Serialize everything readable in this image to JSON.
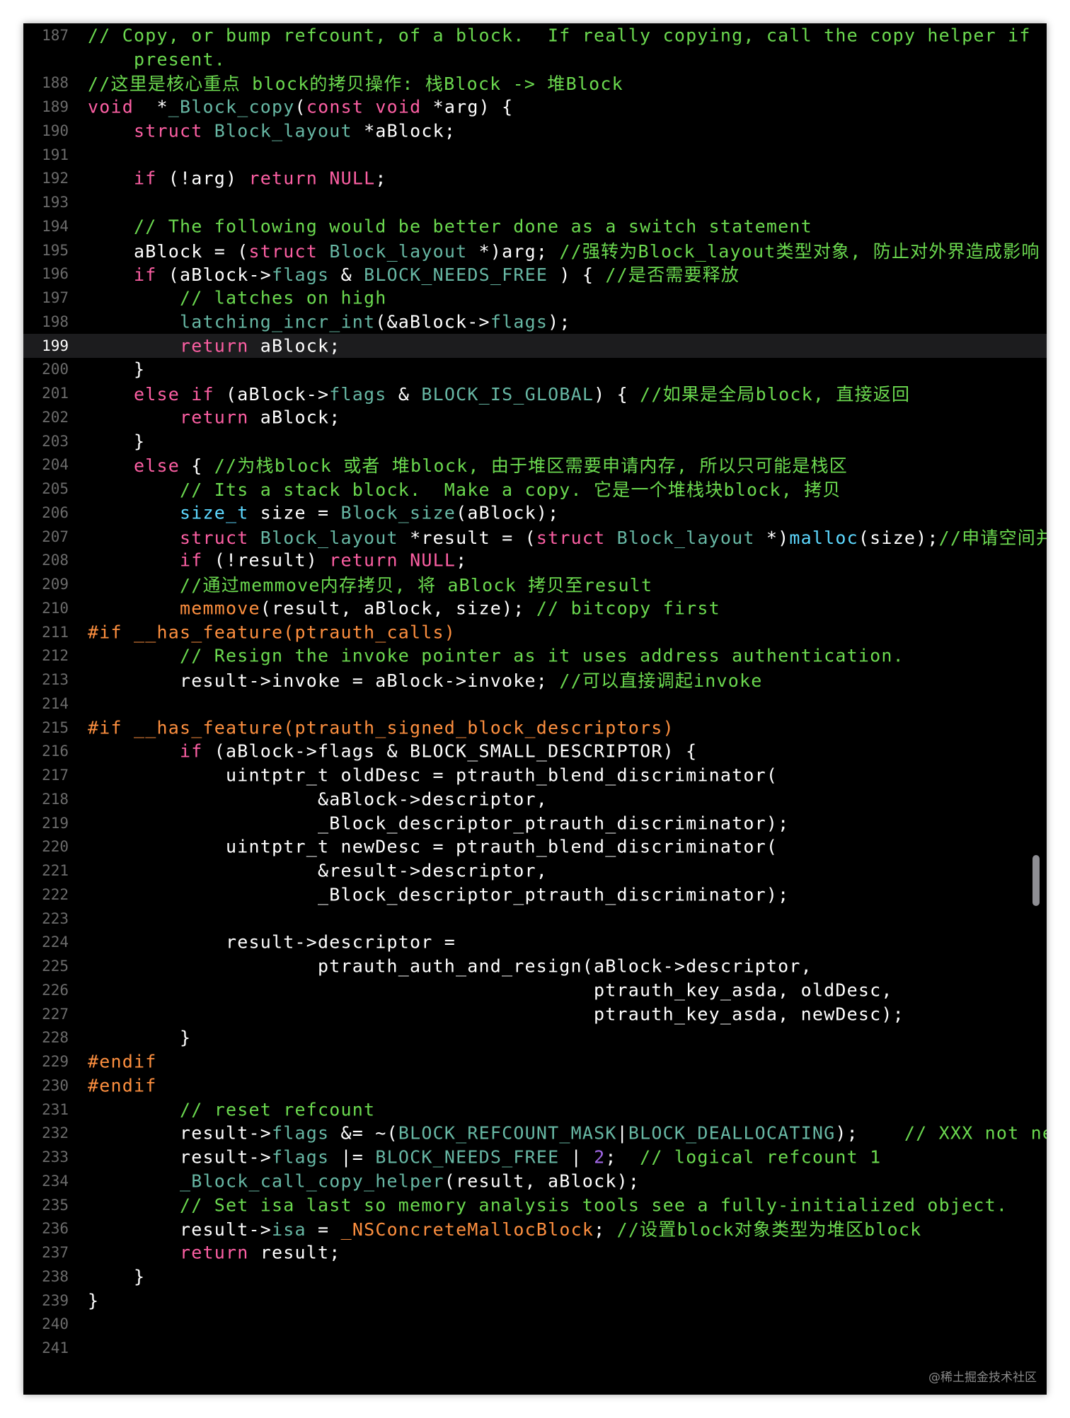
{
  "editor": {
    "colors": {
      "background": "#000000",
      "keyword": "#fc5fa3",
      "type": "#5dd8ff",
      "project_symbol": "#67b7a4",
      "number": "#a167e6",
      "comment": "#6bd94f",
      "preprocessor": "#fd8f3f",
      "function": "#41a1c0",
      "plain": "#ffffff",
      "line_number": "#6b6b6b"
    },
    "current_line": 199,
    "lines": [
      {
        "n": "187",
        "tokens": [
          [
            "c",
            "// Copy, or bump refcount, of a block.  If really copying, call the copy helper if"
          ]
        ]
      },
      {
        "n": "",
        "tokens": [
          [
            "c",
            "    present."
          ]
        ]
      },
      {
        "n": "188",
        "tokens": [
          [
            "c",
            "//这里是核心重点 block的拷贝操作: 栈Block -> 堆Block"
          ]
        ]
      },
      {
        "n": "189",
        "tokens": [
          [
            "k",
            "void"
          ],
          [
            "",
            "  *"
          ],
          [
            "p",
            "_Block_copy"
          ],
          [
            "",
            "("
          ],
          [
            "k",
            "const void"
          ],
          [
            "",
            " *arg) {"
          ]
        ]
      },
      {
        "n": "190",
        "tokens": [
          [
            "",
            "    "
          ],
          [
            "k",
            "struct"
          ],
          [
            "",
            " "
          ],
          [
            "p",
            "Block_layout"
          ],
          [
            "",
            " *aBlock;"
          ]
        ]
      },
      {
        "n": "191",
        "tokens": []
      },
      {
        "n": "192",
        "tokens": [
          [
            "",
            "    "
          ],
          [
            "k",
            "if"
          ],
          [
            "",
            " (!arg) "
          ],
          [
            "k",
            "return"
          ],
          [
            "",
            " "
          ],
          [
            "k",
            "NULL"
          ],
          [
            "",
            ";"
          ]
        ]
      },
      {
        "n": "193",
        "tokens": []
      },
      {
        "n": "194",
        "tokens": [
          [
            "",
            "    "
          ],
          [
            "c",
            "// The following would be better done as a switch statement"
          ]
        ]
      },
      {
        "n": "195",
        "tokens": [
          [
            "",
            "    aBlock = ("
          ],
          [
            "k",
            "struct"
          ],
          [
            "",
            " "
          ],
          [
            "p",
            "Block_layout"
          ],
          [
            "",
            " *)arg; "
          ],
          [
            "c",
            "//强转为Block_layout类型对象, 防止对外界造成影响"
          ]
        ]
      },
      {
        "n": "196",
        "tokens": [
          [
            "",
            "    "
          ],
          [
            "k",
            "if"
          ],
          [
            "",
            " (aBlock->"
          ],
          [
            "p",
            "flags"
          ],
          [
            "",
            " & "
          ],
          [
            "p",
            "BLOCK_NEEDS_FREE"
          ],
          [
            "",
            " ) { "
          ],
          [
            "c",
            "//是否需要释放"
          ]
        ]
      },
      {
        "n": "197",
        "tokens": [
          [
            "",
            "        "
          ],
          [
            "c",
            "// latches on high"
          ]
        ]
      },
      {
        "n": "198",
        "tokens": [
          [
            "",
            "        "
          ],
          [
            "p",
            "latching_incr_int"
          ],
          [
            "",
            "(&aBlock->"
          ],
          [
            "p",
            "flags"
          ],
          [
            "",
            ");"
          ]
        ]
      },
      {
        "n": "199",
        "tokens": [
          [
            "",
            "        "
          ],
          [
            "k",
            "return"
          ],
          [
            "",
            " aBlock;"
          ]
        ]
      },
      {
        "n": "200",
        "tokens": [
          [
            "",
            "    }"
          ]
        ]
      },
      {
        "n": "201",
        "tokens": [
          [
            "",
            "    "
          ],
          [
            "k",
            "else if"
          ],
          [
            "",
            " (aBlock->"
          ],
          [
            "p",
            "flags"
          ],
          [
            "",
            " & "
          ],
          [
            "p",
            "BLOCK_IS_GLOBAL"
          ],
          [
            "",
            ") { "
          ],
          [
            "c",
            "//如果是全局block, 直接返回"
          ]
        ]
      },
      {
        "n": "202",
        "tokens": [
          [
            "",
            "        "
          ],
          [
            "k",
            "return"
          ],
          [
            "",
            " aBlock;"
          ]
        ]
      },
      {
        "n": "203",
        "tokens": [
          [
            "",
            "    }"
          ]
        ]
      },
      {
        "n": "204",
        "tokens": [
          [
            "",
            "    "
          ],
          [
            "k",
            "else"
          ],
          [
            "",
            " { "
          ],
          [
            "c",
            "//为栈block 或者 堆block, 由于堆区需要申请内存, 所以只可能是栈区"
          ]
        ]
      },
      {
        "n": "205",
        "tokens": [
          [
            "",
            "        "
          ],
          [
            "c",
            "// Its a stack block.  Make a copy. 它是一个堆栈块block, 拷贝"
          ]
        ]
      },
      {
        "n": "206",
        "tokens": [
          [
            "",
            "        "
          ],
          [
            "t",
            "size_t"
          ],
          [
            "",
            " size = "
          ],
          [
            "p",
            "Block_size"
          ],
          [
            "",
            "(aBlock);"
          ]
        ]
      },
      {
        "n": "207",
        "tokens": [
          [
            "",
            "        "
          ],
          [
            "k",
            "struct"
          ],
          [
            "",
            " "
          ],
          [
            "p",
            "Block_layout"
          ],
          [
            "",
            " *result = ("
          ],
          [
            "k",
            "struct"
          ],
          [
            "",
            " "
          ],
          [
            "p",
            "Block_layout"
          ],
          [
            "",
            " *)"
          ],
          [
            "t",
            "malloc"
          ],
          [
            "",
            "(size);"
          ],
          [
            "c",
            "//申请空间并接收"
          ]
        ]
      },
      {
        "n": "208",
        "tokens": [
          [
            "",
            "        "
          ],
          [
            "k",
            "if"
          ],
          [
            "",
            " (!result) "
          ],
          [
            "k",
            "return"
          ],
          [
            "",
            " "
          ],
          [
            "k",
            "NULL"
          ],
          [
            "",
            ";"
          ]
        ]
      },
      {
        "n": "209",
        "tokens": [
          [
            "",
            "        "
          ],
          [
            "c",
            "//通过memmove内存拷贝, 将 aBlock 拷贝至result"
          ]
        ]
      },
      {
        "n": "210",
        "tokens": [
          [
            "",
            "        "
          ],
          [
            "h",
            "memmove"
          ],
          [
            "",
            "(result, aBlock, size); "
          ],
          [
            "c",
            "// bitcopy first"
          ]
        ]
      },
      {
        "n": "211",
        "tokens": [
          [
            "h",
            "#if __has_feature(ptrauth_calls)"
          ]
        ]
      },
      {
        "n": "212",
        "tokens": [
          [
            "",
            "        "
          ],
          [
            "c",
            "// Resign the invoke pointer as it uses address authentication."
          ]
        ]
      },
      {
        "n": "213",
        "tokens": [
          [
            "",
            "        result->invoke = aBlock->invoke; "
          ],
          [
            "c",
            "//可以直接调起invoke"
          ]
        ]
      },
      {
        "n": "214",
        "tokens": []
      },
      {
        "n": "215",
        "tokens": [
          [
            "h",
            "#if __has_feature(ptrauth_signed_block_descriptors)"
          ]
        ]
      },
      {
        "n": "216",
        "tokens": [
          [
            "",
            "        "
          ],
          [
            "k",
            "if"
          ],
          [
            "",
            " (aBlock->flags & BLOCK_SMALL_DESCRIPTOR) {"
          ]
        ]
      },
      {
        "n": "217",
        "tokens": [
          [
            "",
            "            uintptr_t oldDesc = ptrauth_blend_discriminator("
          ]
        ]
      },
      {
        "n": "218",
        "tokens": [
          [
            "",
            "                    &aBlock->descriptor,"
          ]
        ]
      },
      {
        "n": "219",
        "tokens": [
          [
            "",
            "                    _Block_descriptor_ptrauth_discriminator);"
          ]
        ]
      },
      {
        "n": "220",
        "tokens": [
          [
            "",
            "            uintptr_t newDesc = ptrauth_blend_discriminator("
          ]
        ]
      },
      {
        "n": "221",
        "tokens": [
          [
            "",
            "                    &result->descriptor,"
          ]
        ]
      },
      {
        "n": "222",
        "tokens": [
          [
            "",
            "                    _Block_descriptor_ptrauth_discriminator);"
          ]
        ]
      },
      {
        "n": "223",
        "tokens": []
      },
      {
        "n": "224",
        "tokens": [
          [
            "",
            "            result->descriptor ="
          ]
        ]
      },
      {
        "n": "225",
        "tokens": [
          [
            "",
            "                    ptrauth_auth_and_resign(aBlock->descriptor,"
          ]
        ]
      },
      {
        "n": "226",
        "tokens": [
          [
            "",
            "                                            ptrauth_key_asda, oldDesc,"
          ]
        ]
      },
      {
        "n": "227",
        "tokens": [
          [
            "",
            "                                            ptrauth_key_asda, newDesc);"
          ]
        ]
      },
      {
        "n": "228",
        "tokens": [
          [
            "",
            "        }"
          ]
        ]
      },
      {
        "n": "229",
        "tokens": [
          [
            "h",
            "#endif"
          ]
        ]
      },
      {
        "n": "230",
        "tokens": [
          [
            "h",
            "#endif"
          ]
        ]
      },
      {
        "n": "231",
        "tokens": [
          [
            "",
            "        "
          ],
          [
            "c",
            "// reset refcount"
          ]
        ]
      },
      {
        "n": "232",
        "tokens": [
          [
            "",
            "        result->"
          ],
          [
            "p",
            "flags"
          ],
          [
            "",
            " &= ~("
          ],
          [
            "p",
            "BLOCK_REFCOUNT_MASK"
          ],
          [
            "",
            "|"
          ],
          [
            "p",
            "BLOCK_DEALLOCATING"
          ],
          [
            "",
            ");    "
          ],
          [
            "c",
            "// XXX not needed"
          ]
        ]
      },
      {
        "n": "233",
        "tokens": [
          [
            "",
            "        result->"
          ],
          [
            "p",
            "flags"
          ],
          [
            "",
            " |= "
          ],
          [
            "p",
            "BLOCK_NEEDS_FREE"
          ],
          [
            "",
            " | "
          ],
          [
            "m",
            "2"
          ],
          [
            "",
            ";  "
          ],
          [
            "c",
            "// logical refcount 1"
          ]
        ]
      },
      {
        "n": "234",
        "tokens": [
          [
            "",
            "        "
          ],
          [
            "p",
            "_Block_call_copy_helper"
          ],
          [
            "",
            "(result, aBlock);"
          ]
        ]
      },
      {
        "n": "235",
        "tokens": [
          [
            "",
            "        "
          ],
          [
            "c",
            "// Set isa last so memory analysis tools see a fully-initialized object."
          ]
        ]
      },
      {
        "n": "236",
        "tokens": [
          [
            "",
            "        result->"
          ],
          [
            "p",
            "isa"
          ],
          [
            "",
            " = "
          ],
          [
            "h",
            "_NSConcreteMallocBlock"
          ],
          [
            "",
            "; "
          ],
          [
            "c",
            "//设置block对象类型为堆区block"
          ]
        ]
      },
      {
        "n": "237",
        "tokens": [
          [
            "",
            "        "
          ],
          [
            "k",
            "return"
          ],
          [
            "",
            " result;"
          ]
        ]
      },
      {
        "n": "238",
        "tokens": [
          [
            "",
            "    }"
          ]
        ]
      },
      {
        "n": "239",
        "tokens": [
          [
            "",
            "}"
          ]
        ]
      },
      {
        "n": "240",
        "tokens": []
      },
      {
        "n": "241",
        "tokens": []
      }
    ]
  },
  "watermark": "@稀土掘金技术社区"
}
